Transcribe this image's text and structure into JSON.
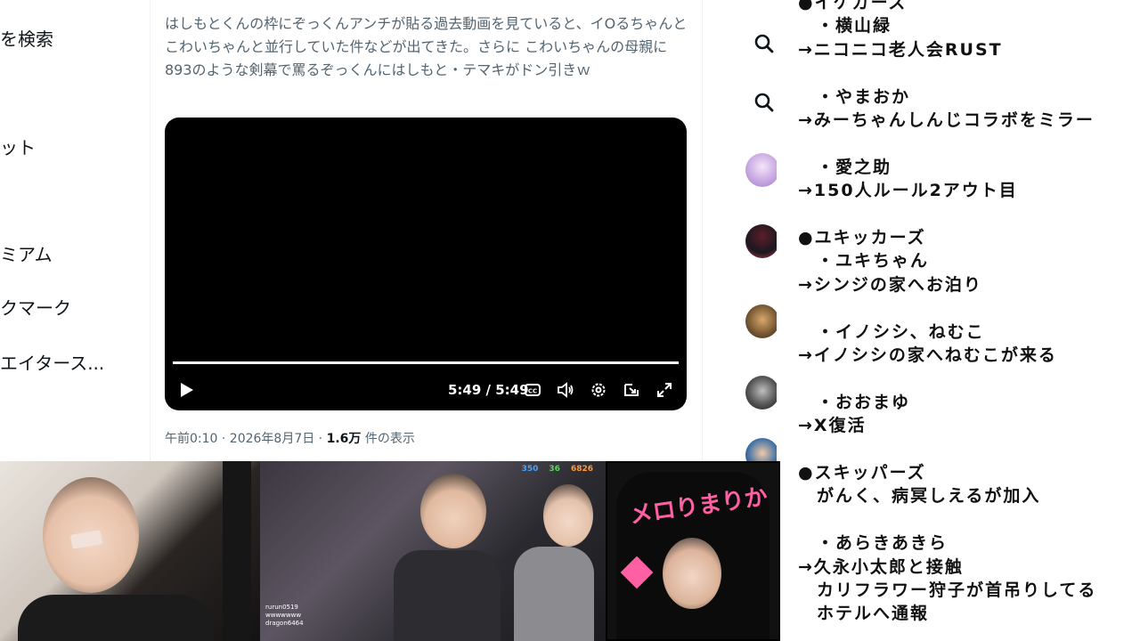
{
  "left_nav": {
    "items": [
      {
        "label": "を検索"
      },
      {
        "label": "ット"
      },
      {
        "label": "ミアム"
      },
      {
        "label": "クマーク"
      },
      {
        "label": "エイタース..."
      }
    ]
  },
  "tweet": {
    "text": "はしもとくんの枠にぞっくんアンチが貼る過去動画を見ていると、イOるちゃんとこわいちゃんと並行していた件などが出てきた。さらに こわいちゃんの母親に893のような剣幕で罵るぞっくんにはしもと・テマキがドン引きｗ",
    "video": {
      "time_display": "5:49 / 5:49",
      "progress": 1.0
    },
    "meta": {
      "datetime": "午前0:10 · 2026年8月7日 · ",
      "views_count": "1.6万",
      "views_suffix": " 件の表示"
    }
  },
  "right_panel": {
    "lines": [
      "●イケガーズ",
      "　・横山緑",
      "→ニコニコ老人会RUST",
      "",
      "　・やまおか",
      "→みーちゃんしんじコラボをミラー",
      "",
      "　・愛之助",
      "→150人ルール2アウト目",
      "",
      "●ユキッカーズ",
      "　・ユキちゃん",
      "→シンジの家へお泊り",
      "",
      "　・イノシシ、ねむこ",
      "→イノシシの家へねむこが来る",
      "",
      "　・おおまゆ",
      "→X復活",
      "",
      "●スキッパーズ",
      "　がんく、病冥しえるが加入",
      "",
      "　・あらきあきら",
      "→久永小太郎と接触",
      "　カリフラワー狩子が首吊りしてる",
      "　ホテルへ通報"
    ]
  },
  "stream": {
    "stat_1": "350",
    "stat_2": "36",
    "stat_3": "6826",
    "chat_user_1": "rurun0519",
    "chat_msg_1": "wwwwwww",
    "chat_user_2": "dragon6464"
  },
  "shirt": {
    "title": "メロりまりか"
  },
  "colors": {
    "text_secondary": "#536471",
    "pink_accent": "#ff5fa3",
    "stat_blue": "#4aa3ff",
    "stat_green": "#57d957",
    "stat_orange": "#ff9a3d"
  }
}
